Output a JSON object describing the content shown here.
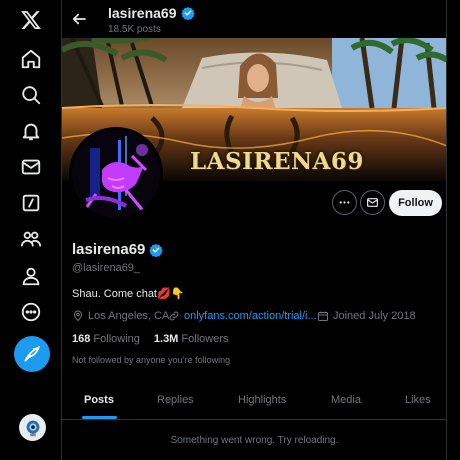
{
  "header": {
    "display_name": "lasirena69",
    "post_count": "18.5K posts"
  },
  "banner": {
    "overlay_text": "LASIRENA69"
  },
  "profile": {
    "display_name": "lasirena69",
    "handle": "@lasirena69_",
    "bio": "Shau. Come chat💋👇",
    "location": "Los Angeles, CA",
    "link": "onlyfans.com/action/trial/i...",
    "joined": "Joined July 2018",
    "following_count": "168",
    "following_label": "Following",
    "followers_count": "1.3M",
    "followers_label": "Followers",
    "not_followed": "Not followed by anyone you’re following",
    "follow_label": "Follow"
  },
  "tabs": [
    "Posts",
    "Replies",
    "Highlights",
    "Media",
    "Likes"
  ],
  "active_tab": "Posts",
  "message": "Something went wrong. Try reloading.",
  "colors": {
    "accent": "#1d9bf0",
    "background": "#000000",
    "text": "#e7e9ea",
    "muted": "#71767b",
    "border": "#2f3336"
  },
  "icons": {
    "nav": [
      "x-logo-icon",
      "home-icon",
      "explore-icon",
      "notifications-icon",
      "messages-icon",
      "grok-icon",
      "communities-icon",
      "profile-icon",
      "more-icon",
      "compose-post-icon"
    ],
    "verified": "verified-badge-icon"
  }
}
